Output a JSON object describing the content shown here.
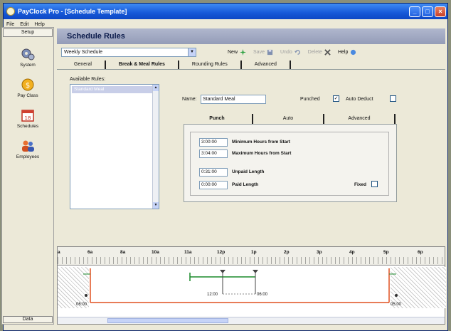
{
  "window": {
    "title": "PayClock Pro - [Schedule Template]"
  },
  "menu": [
    "File",
    "Edit",
    "Help"
  ],
  "sidebar": {
    "header": "Setup",
    "items": [
      {
        "label": "System",
        "icon": "gears-icon"
      },
      {
        "label": "Pay Class",
        "icon": "coin-icon"
      },
      {
        "label": "Schedules",
        "icon": "calendar-icon"
      },
      {
        "label": "Employees",
        "icon": "people-icon"
      }
    ],
    "footer": "Data"
  },
  "main": {
    "title": "Schedule Rules",
    "schedule_select": "Weekly Schedule",
    "toolbar": [
      {
        "label": "New",
        "icon": "new-icon",
        "enabled": true
      },
      {
        "label": "Save",
        "icon": "save-icon",
        "enabled": false
      },
      {
        "label": "Undo",
        "icon": "undo-icon",
        "enabled": false
      },
      {
        "label": "Delete",
        "icon": "delete-icon",
        "enabled": false
      },
      {
        "label": "Help",
        "icon": "help-icon",
        "enabled": true
      }
    ],
    "tabs": [
      "General",
      "Break & Meal Rules",
      "Rounding Rules",
      "Advanced"
    ],
    "active_tab": 1,
    "available_rules_label": "Available Rules:",
    "rules": [
      "Standard Meal"
    ],
    "name_label": "Name:",
    "name_value": "Standard Meal",
    "punched_label": "Punched",
    "punched_checked": true,
    "auto_deduct_label": "Auto Deduct",
    "auto_deduct_checked": false,
    "subtabs": [
      "Punch",
      "Auto",
      "Advanced"
    ],
    "active_subtab": 0,
    "fields": [
      {
        "value": "3:00:00",
        "label": "Minimum Hours from Start"
      },
      {
        "value": "3:04:00",
        "label": "Maximum Hours from Start"
      },
      {
        "value": "0:31:00",
        "label": "Unpaid Length"
      },
      {
        "value": "0:00:00",
        "label": "Paid Length"
      }
    ],
    "fixed_label": "Fixed",
    "fixed_checked": false
  },
  "timeline": {
    "ticks": [
      "a",
      "6a",
      "8a",
      "10a",
      "11a",
      "12p",
      "1p",
      "2p",
      "3p",
      "4p",
      "5p",
      "6p"
    ],
    "times": [
      "06:00",
      "12:00",
      "06:00",
      "05:00"
    ]
  },
  "colors": {
    "title_bar": "#1658d8",
    "header": "#949cb8",
    "shift_line": "#e05020",
    "break_line": "#1a8a2a"
  }
}
